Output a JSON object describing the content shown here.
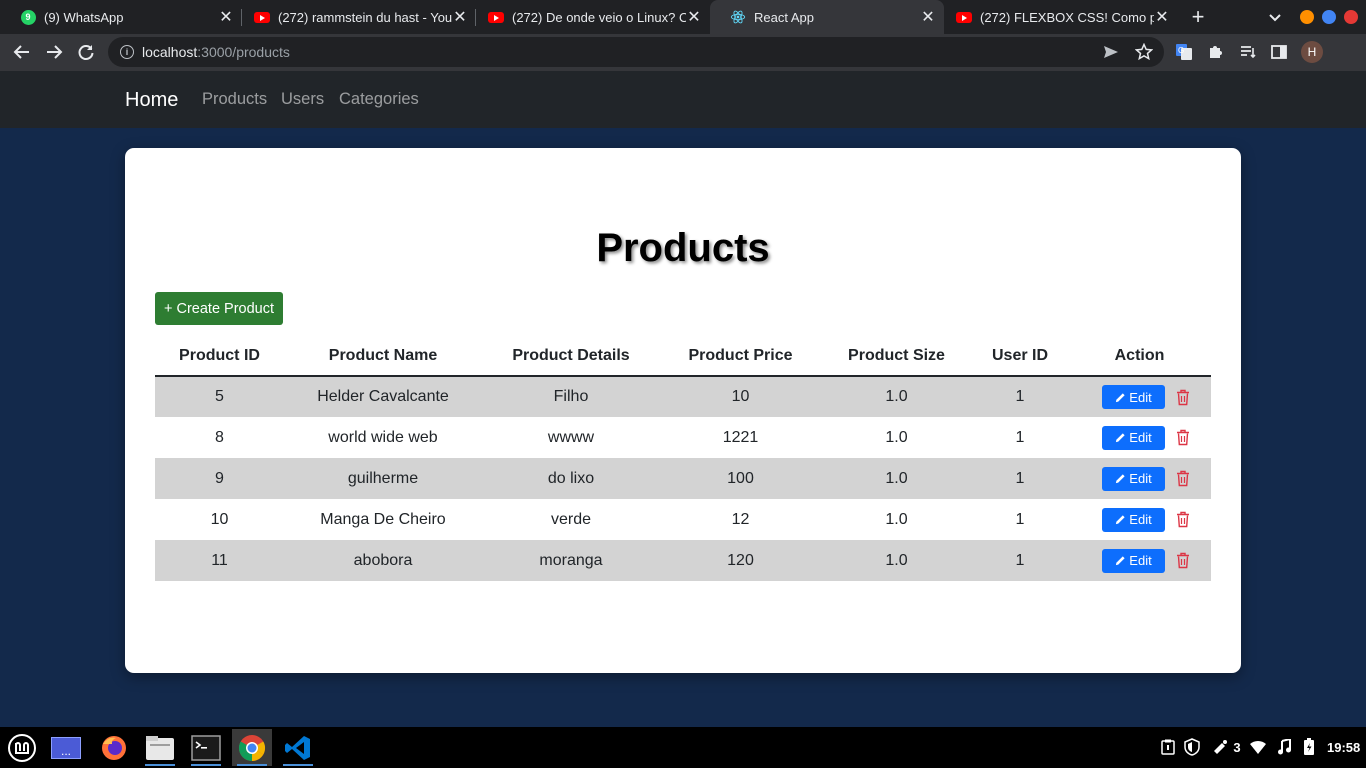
{
  "browser": {
    "tabs": [
      {
        "title": "(9) WhatsApp",
        "icon": "whatsapp-icon",
        "active": false
      },
      {
        "title": "(272) rammstein du hast - You",
        "icon": "youtube-icon",
        "active": false
      },
      {
        "title": "(272) De onde veio o Linux? O",
        "icon": "youtube-icon",
        "active": false
      },
      {
        "title": "React App",
        "icon": "react-icon",
        "active": true
      },
      {
        "title": "(272) FLEXBOX CSS! Como p",
        "icon": "youtube-icon",
        "active": false
      }
    ],
    "url_host": "localhost",
    "url_path": ":3000/products",
    "profile_initial": "H",
    "colors": {
      "window_min": "#ff8f00",
      "window_max": "#4285f4",
      "window_close": "#e53935"
    }
  },
  "navbar": {
    "brand": "Home",
    "links": [
      "Products",
      "Users",
      "Categories"
    ]
  },
  "main": {
    "title": "Products",
    "create_label": "+ Create Product",
    "table": {
      "headers": [
        "Product ID",
        "Product Name",
        "Product Details",
        "Product Price",
        "Product Size",
        "User ID",
        "Action"
      ],
      "rows": [
        {
          "id": "5",
          "name": "Helder Cavalcante",
          "details": "Filho",
          "price": "10",
          "size": "1.0",
          "user": "1"
        },
        {
          "id": "8",
          "name": "world wide web",
          "details": "wwww",
          "price": "1221",
          "size": "1.0",
          "user": "1"
        },
        {
          "id": "9",
          "name": "guilherme",
          "details": "do lixo",
          "price": "100",
          "size": "1.0",
          "user": "1"
        },
        {
          "id": "10",
          "name": "Manga De Cheiro",
          "details": "verde",
          "price": "12",
          "size": "1.0",
          "user": "1"
        },
        {
          "id": "11",
          "name": "abobora",
          "details": "moranga",
          "price": "120",
          "size": "1.0",
          "user": "1"
        }
      ],
      "edit_label": "Edit"
    },
    "colors": {
      "create": "#2e7d32",
      "edit": "#0d6efd",
      "delete": "#dc3545",
      "stripe": "#d3d3d3",
      "background": "#13294b"
    }
  },
  "taskbar": {
    "apps": [
      "mint-menu-icon",
      "workspace-icon",
      "firefox-icon",
      "files-icon",
      "terminal-icon",
      "chrome-icon",
      "vscode-icon"
    ],
    "workspace_label": "...",
    "notification_count": "3",
    "clock": "19:58"
  }
}
